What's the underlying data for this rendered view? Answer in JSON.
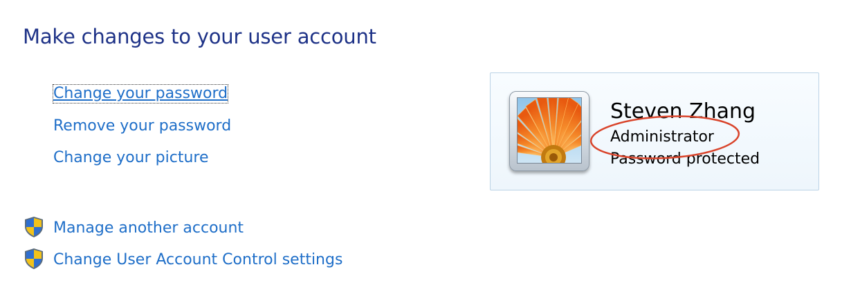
{
  "page": {
    "title": "Make changes to your user account"
  },
  "tasks": {
    "change_password": "Change your password",
    "remove_password": "Remove your password",
    "change_picture": "Change your picture"
  },
  "admin_tasks": {
    "manage_another_account": "Manage another account",
    "uac_settings": "Change User Account Control settings"
  },
  "account": {
    "name": "Steven Zhang",
    "role": "Administrator",
    "status": "Password protected",
    "picture": "orange-flower-picture"
  },
  "icons": {
    "uac_shield": "uac-shield-icon"
  },
  "colors": {
    "title": "#1e3287",
    "link": "#1e6ec8",
    "annotation": "#d9442b",
    "card_border": "#bcd3e6"
  }
}
